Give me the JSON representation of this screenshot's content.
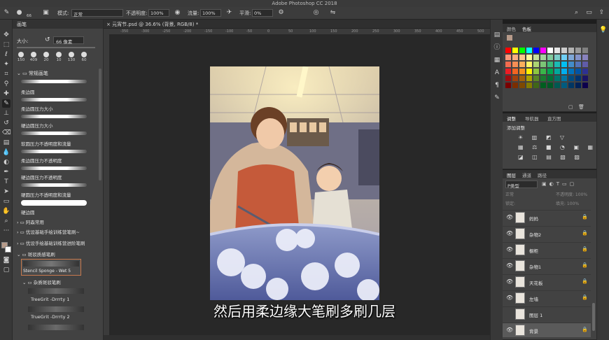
{
  "app": {
    "title": "Adobe Photoshop CC 2018"
  },
  "options_bar": {
    "brush_size": "66",
    "mode_label": "模式:",
    "mode_value": "正常",
    "opacity_label": "不透明度:",
    "opacity_value": "100%",
    "flow_label": "流量:",
    "flow_value": "100%",
    "smoothing_label": "平滑:",
    "smoothing_value": "0%"
  },
  "brush_panel": {
    "tab": "画笔",
    "size_label": "大小:",
    "size_value": "66 像素",
    "presets": [
      "150",
      "409",
      "20",
      "10",
      "130",
      "60"
    ],
    "group_general": "常规画笔",
    "brushes": [
      "柔边圆",
      "柔边圆压力大小",
      "硬边圆压力大小",
      "软圆压力不透明度和流量",
      "柔边圆压力不透明度",
      "硬边圆压力不透明度",
      "硬圆压力不透明度和流量",
      "硬边圆"
    ],
    "folders": [
      "阿森常用",
      "优设基础手绘训练营笔刷~",
      "优设手绘基础训练营进阶笔刷",
      "斑驳质感笔刷"
    ],
    "selected_brush": "Stencil Sponge - Wet 5",
    "subfolder": "杂质斑驳笔刷",
    "sub_brushes": [
      "TreeGrit -Drrrty 1",
      "TrueGrit -Drrrty 2"
    ]
  },
  "document": {
    "tab_title": "元宵节.psd @ 36.6% (背景, RGB/8) *",
    "ruler_marks": [
      "-350",
      "-300",
      "-250",
      "-200",
      "-150",
      "-100",
      "-50",
      "0",
      "50",
      "100",
      "150",
      "200",
      "250",
      "300",
      "350",
      "400",
      "450",
      "500"
    ]
  },
  "swatches_panel": {
    "tabs": [
      "颜色",
      "色板"
    ],
    "colors": [
      "#ff0000",
      "#ffff00",
      "#00ff00",
      "#00ffff",
      "#0000ff",
      "#ff00ff",
      "#ffffff",
      "#e6e6e6",
      "#cccccc",
      "#b3b3b3",
      "#999999",
      "#808080",
      "#f7977a",
      "#f9ad81",
      "#fdc68a",
      "#fff79a",
      "#c4df9b",
      "#a2d39c",
      "#82ca9d",
      "#7bcdc8",
      "#6ecff6",
      "#7ea7d8",
      "#8493ca",
      "#8882be",
      "#f26c4f",
      "#f68e55",
      "#fbaf5c",
      "#fff467",
      "#acd372",
      "#7cc576",
      "#3bb878",
      "#1abbb4",
      "#00bff3",
      "#438cca",
      "#5574b9",
      "#605ca8",
      "#ed1c24",
      "#f26522",
      "#f7941d",
      "#fff200",
      "#8dc63f",
      "#39b54a",
      "#00a651",
      "#00a99d",
      "#00aeef",
      "#0072bc",
      "#0054a6",
      "#2e3192",
      "#9e0b0f",
      "#a0410d",
      "#a36209",
      "#aba000",
      "#598527",
      "#1a7b30",
      "#007236",
      "#00746b",
      "#0076a3",
      "#004b80",
      "#003471",
      "#1b1464",
      "#790000",
      "#7b2e00",
      "#7d4900",
      "#827b00",
      "#406618",
      "#005e20",
      "#005826",
      "#005952",
      "#005b7f",
      "#003663",
      "#002157",
      "#0d004c"
    ]
  },
  "adjust_panel": {
    "tabs": [
      "调整",
      "导航器",
      "直方图"
    ],
    "label": "添加调整",
    "row1": "☀ ▥ ◩ ▽",
    "row2": "▦ ⚖ ■ ◔ ▣ ▦",
    "row3": "◪ ◫ ▤ ▧ ▨"
  },
  "layers_panel": {
    "tabs": [
      "图层",
      "通道",
      "路径"
    ],
    "filter": "P类型",
    "blend_mode": "正常",
    "opacity": "不透明度: 100%",
    "lock": "锁定:",
    "fill": "填充: 100%",
    "layers": [
      "妈妈",
      "杂物2",
      "橱柜",
      "杂物1",
      "天花板",
      "左墙",
      "图层 1",
      "背景"
    ]
  },
  "subtitle": "然后用柔边缘大笔刷多刷几层"
}
